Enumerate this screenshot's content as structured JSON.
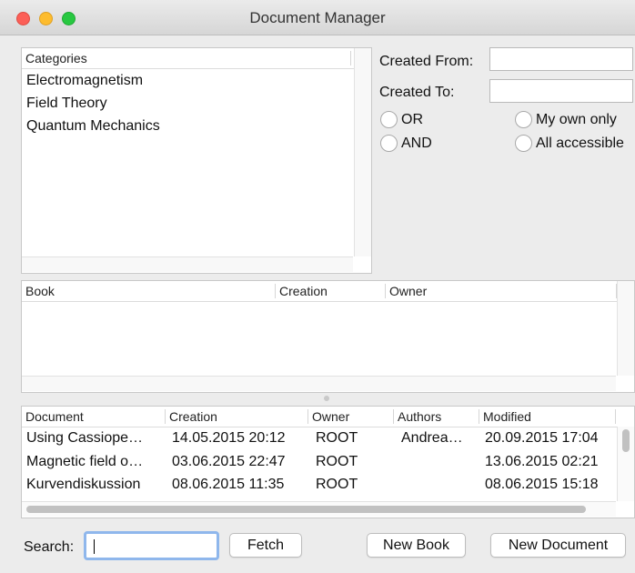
{
  "window": {
    "title": "Document Manager"
  },
  "categories": {
    "header": "Categories",
    "items": [
      "Electromagnetism",
      "Field Theory",
      "Quantum Mechanics"
    ]
  },
  "filters": {
    "created_from_label": "Created From:",
    "created_from_value": "",
    "created_to_label": "Created To:",
    "created_to_value": "",
    "or_label": "OR",
    "and_label": "AND",
    "my_own_label": "My own only",
    "all_accessible_label": "All accessible"
  },
  "books": {
    "columns": [
      "Book",
      "Creation",
      "Owner"
    ],
    "rows": []
  },
  "documents": {
    "columns": [
      "Document",
      "Creation",
      "Owner",
      "Authors",
      "Modified"
    ],
    "rows": [
      [
        "Using Cassiope…",
        "14.05.2015 20:12",
        "ROOT",
        "Andrea…",
        "20.09.2015 17:04"
      ],
      [
        "Magnetic field o…",
        "03.06.2015 22:47",
        "ROOT",
        "",
        "13.06.2015 02:21"
      ],
      [
        "Kurvendiskussion",
        "08.06.2015 11:35",
        "ROOT",
        "",
        "08.06.2015 15:18"
      ]
    ]
  },
  "footer": {
    "search_label": "Search:",
    "search_value": "",
    "fetch_label": "Fetch",
    "new_book_label": "New Book",
    "new_document_label": "New Document"
  }
}
